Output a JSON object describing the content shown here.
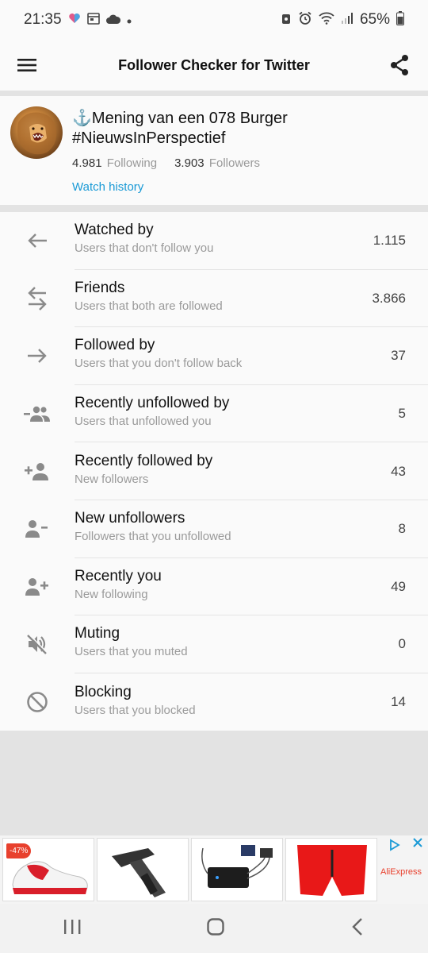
{
  "status_bar": {
    "time": "21:35",
    "battery": "65%"
  },
  "app_bar": {
    "title": "Follower Checker for Twitter"
  },
  "profile": {
    "name": "⚓Mening van een 078 Burger #NieuwsInPerspectief",
    "following_count": "4.981",
    "following_label": "Following",
    "followers_count": "3.903",
    "followers_label": "Followers",
    "watch_history": "Watch history"
  },
  "list": [
    {
      "title": "Watched by",
      "subtitle": "Users that don't follow you",
      "count": "1.115",
      "icon": "arrow-left-icon"
    },
    {
      "title": "Friends",
      "subtitle": "Users that both are followed",
      "count": "3.866",
      "icon": "swap-arrows-icon"
    },
    {
      "title": "Followed by",
      "subtitle": "Users that you don't follow back",
      "count": "37",
      "icon": "arrow-right-icon"
    },
    {
      "title": "Recently unfollowed by",
      "subtitle": "Users that unfollowed you",
      "count": "5",
      "icon": "group-remove-icon"
    },
    {
      "title": "Recently followed by",
      "subtitle": "New followers",
      "count": "43",
      "icon": "person-add-left-icon"
    },
    {
      "title": "New unfollowers",
      "subtitle": "Followers that you unfollowed",
      "count": "8",
      "icon": "person-remove-icon"
    },
    {
      "title": "Recently you",
      "subtitle": "New following",
      "count": "49",
      "icon": "person-add-right-icon"
    },
    {
      "title": "Muting",
      "subtitle": "Users that you muted",
      "count": "0",
      "icon": "volume-off-icon"
    },
    {
      "title": "Blocking",
      "subtitle": "Users that you blocked",
      "count": "14",
      "icon": "block-icon"
    }
  ],
  "ads": {
    "discount_badge": "-47%",
    "brand": "AliExpress"
  },
  "colors": {
    "accent": "#1a9ad6",
    "icon_gray": "#8a8a8a",
    "background": "#fafafa"
  }
}
